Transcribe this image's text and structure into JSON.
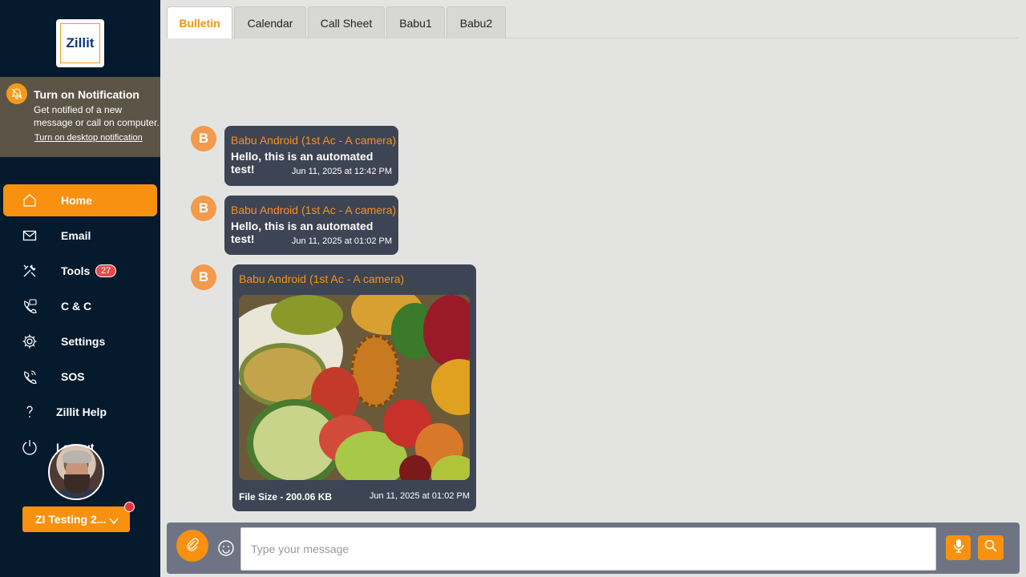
{
  "sidebar": {
    "logo_text": "Zillit",
    "notification": {
      "title": "Turn on Notification",
      "description": "Get notified of a new message or call on computer.",
      "link": "Turn on desktop notification"
    },
    "nav": [
      {
        "label": "Home",
        "icon": "home-icon"
      },
      {
        "label": "Email",
        "icon": "mail-icon"
      },
      {
        "label": "Tools",
        "icon": "tools-icon",
        "badge": "27"
      },
      {
        "label": "C & C",
        "icon": "phone-chat-icon"
      },
      {
        "label": "Settings",
        "icon": "gear-icon"
      },
      {
        "label": "SOS",
        "icon": "sos-phone-icon"
      },
      {
        "label": "Zillit Help",
        "icon": "question-icon"
      },
      {
        "label": "Logout",
        "icon": "power-icon"
      }
    ],
    "project_label": "ZI Testing 2..."
  },
  "tabs": [
    "Bulletin",
    "Calendar",
    "Call Sheet",
    "Babu1",
    "Babu2"
  ],
  "active_tab": "Bulletin",
  "messages": [
    {
      "avatar": "B",
      "sender": "Babu Android (1st Ac - A camera)",
      "text": "Hello, this is an automated test!",
      "time": "Jun 11, 2025 at 12:42 PM"
    },
    {
      "avatar": "B",
      "sender": "Babu Android (1st Ac - A camera)",
      "text": "Hello, this is an automated test!",
      "time": "Jun 11, 2025 at 01:02 PM"
    },
    {
      "avatar": "B",
      "sender": "Babu Android (1st Ac - A camera)",
      "file_size": "File Size - 200.06 KB",
      "time": "Jun 11, 2025 at 01:02 PM"
    }
  ],
  "composer": {
    "placeholder": "Type your message"
  },
  "colors": {
    "accent": "#f7910f",
    "sidebar_bg": "#061a2e",
    "bubble_bg": "#3d4454",
    "sender": "#f7921e"
  }
}
